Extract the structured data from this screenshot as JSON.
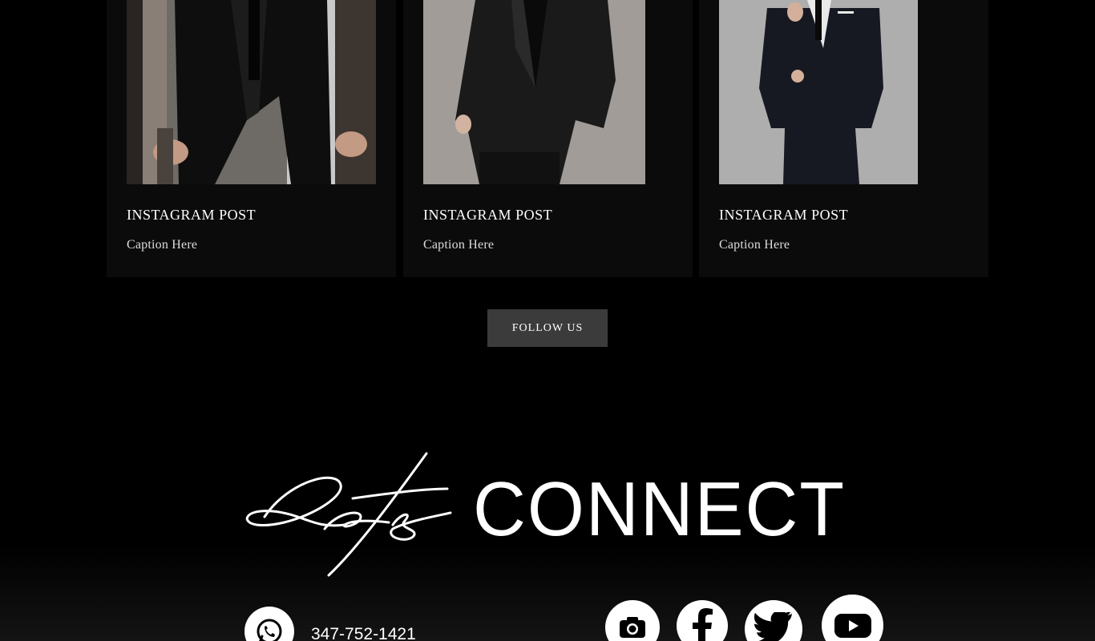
{
  "posts": [
    {
      "title": "INSTAGRAM POST",
      "caption": "Caption Here"
    },
    {
      "title": "INSTAGRAM POST",
      "caption": "Caption Here"
    },
    {
      "title": "INSTAGRAM POST",
      "caption": "Caption Here"
    }
  ],
  "follow": {
    "label": "FOLLOW US"
  },
  "connect": {
    "script_word": "Let's",
    "word": "CONNECT"
  },
  "contact": {
    "phone": "347-752-1421",
    "phone_icon": "whatsapp-icon"
  },
  "social": [
    {
      "name": "instagram",
      "icon": "camera-icon"
    },
    {
      "name": "facebook",
      "icon": "facebook-icon"
    },
    {
      "name": "twitter",
      "icon": "twitter-icon"
    },
    {
      "name": "youtube",
      "icon": "youtube-icon"
    }
  ],
  "colors": {
    "background": "#000000",
    "card": "#0b0b0b",
    "button": "#3b3b3b",
    "text": "#ffffff"
  }
}
